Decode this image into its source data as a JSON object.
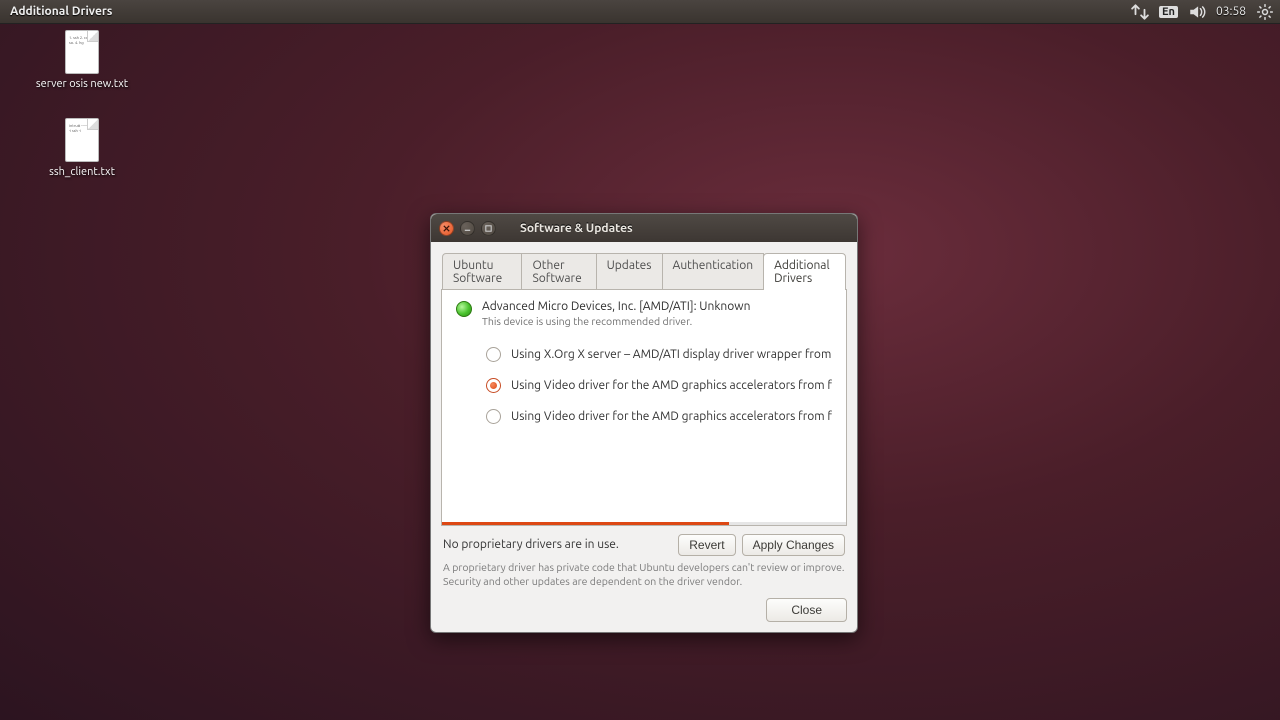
{
  "menubar": {
    "title": "Additional Drivers",
    "lang": "En",
    "clock": "03:58"
  },
  "desktop": {
    "icons": [
      {
        "label": "server osis new.txt",
        "preview": "1. ssh\n2. cd\n3. so.\n4. hg"
      },
      {
        "label": "ssh_client.txt",
        "preview": "intru#\n-----\nssh -i\nssh -i"
      }
    ]
  },
  "dialog": {
    "title": "Software & Updates",
    "tabs": [
      "Ubuntu Software",
      "Other Software",
      "Updates",
      "Authentication",
      "Additional Drivers"
    ],
    "active_tab": "Additional Drivers",
    "device": {
      "title": "Advanced Micro Devices, Inc. [AMD/ATI]: Unknown",
      "subtitle": "This device is using the recommended driver."
    },
    "options": [
      {
        "label": "Using X.Org X server – AMD/ATI display driver wrapper from xserver-xo",
        "selected": false
      },
      {
        "label": "Using Video driver for the AMD graphics accelerators from fglrx-update",
        "selected": true
      },
      {
        "label": "Using Video driver for the AMD graphics accelerators from fglrx (propri",
        "selected": false
      }
    ],
    "progress_percent": 71,
    "status": "No proprietary drivers are in use.",
    "revert_label": "Revert",
    "apply_label": "Apply Changes",
    "footnote": "A proprietary driver has private code that Ubuntu developers can't review or improve. Security and other updates are dependent on the driver vendor.",
    "close_label": "Close"
  }
}
